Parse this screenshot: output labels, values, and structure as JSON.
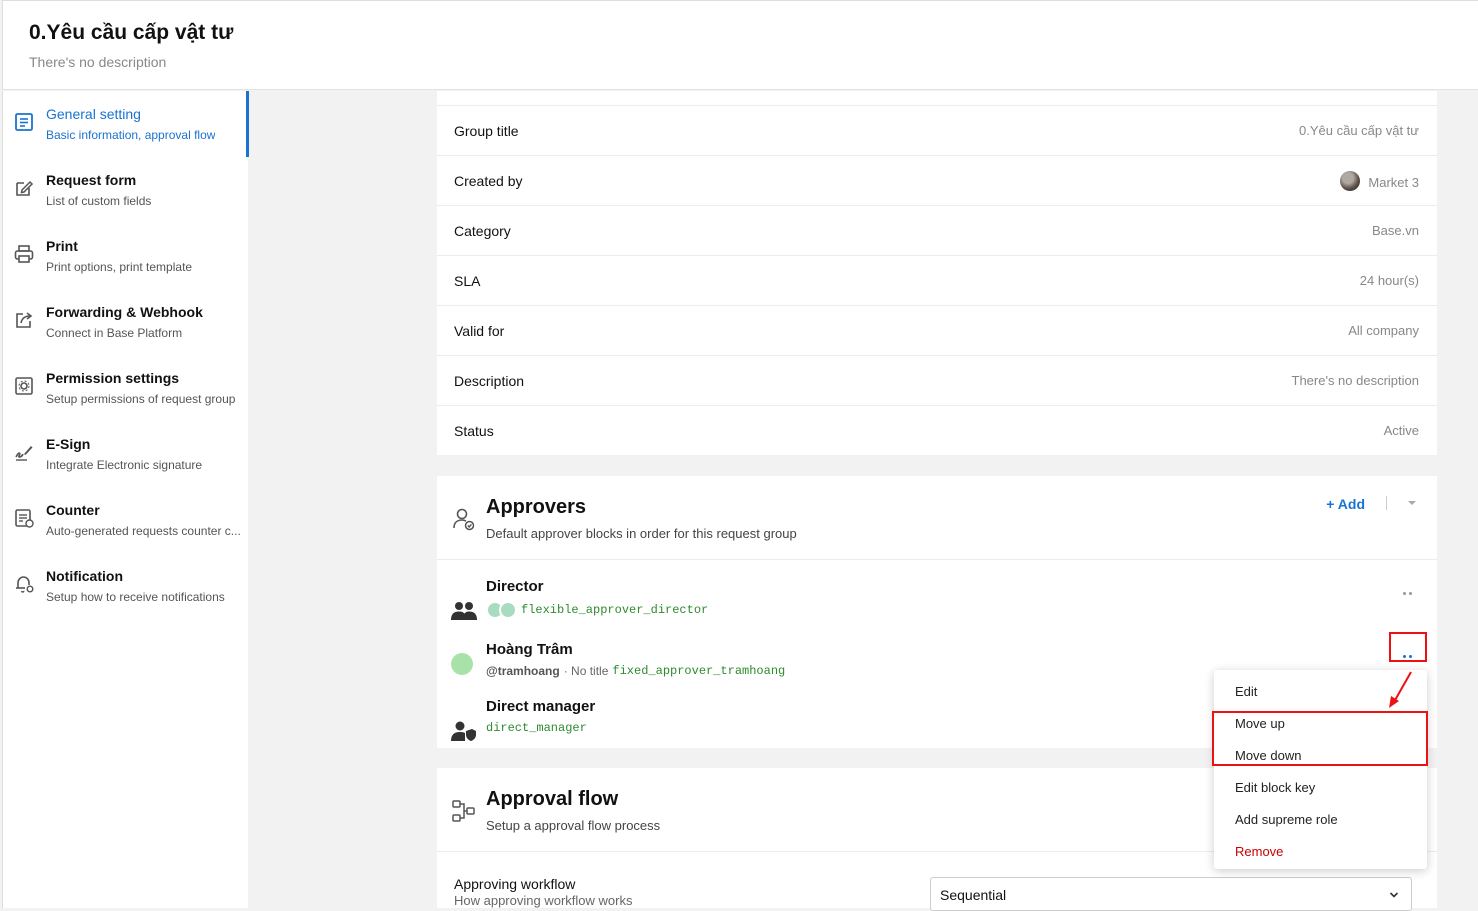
{
  "header": {
    "title": "0.Yêu cầu cấp vật tư",
    "description": "There's no description"
  },
  "sidebar": {
    "items": [
      {
        "label": "General setting",
        "sub": "Basic information, approval flow",
        "icon": "document-icon",
        "active": true
      },
      {
        "label": "Request form",
        "sub": "List of custom fields",
        "icon": "edit-icon"
      },
      {
        "label": "Print",
        "sub": "Print options, print template",
        "icon": "printer-icon"
      },
      {
        "label": "Forwarding & Webhook",
        "sub": "Connect in Base Platform",
        "icon": "share-icon"
      },
      {
        "label": "Permission settings",
        "sub": "Setup permissions of request group",
        "icon": "gear-icon"
      },
      {
        "label": "E-Sign",
        "sub": "Integrate Electronic signature",
        "icon": "signature-icon"
      },
      {
        "label": "Counter",
        "sub": "Auto-generated requests counter c...",
        "icon": "counter-icon"
      },
      {
        "label": "Notification",
        "sub": "Setup how to receive notifications",
        "icon": "bell-icon"
      }
    ]
  },
  "info": {
    "rows": [
      {
        "key": "Group title",
        "value": "0.Yêu cầu cấp vật tư"
      },
      {
        "key": "Created by",
        "value": "Market 3"
      },
      {
        "key": "Category",
        "value": "Base.vn"
      },
      {
        "key": "SLA",
        "value": "24 hour(s)"
      },
      {
        "key": "Valid for",
        "value": "All company"
      },
      {
        "key": "Description",
        "value": "There's no description"
      },
      {
        "key": "Status",
        "value": "Active"
      }
    ]
  },
  "approvers": {
    "title": "Approvers",
    "subtitle": "Default approver blocks in order for this request group",
    "add_label": "Add",
    "items": [
      {
        "name": "Director",
        "code": "flexible_approver_director"
      },
      {
        "name": "Hoàng Trâm",
        "handle": "@tramhoang",
        "note": "· No title",
        "code": "fixed_approver_tramhoang"
      },
      {
        "name": "Direct manager",
        "code": "direct_manager"
      }
    ]
  },
  "flow": {
    "title": "Approval flow",
    "subtitle": "Setup a approval flow process",
    "workflow_label": "Approving workflow",
    "workflow_sub": "How approving workflow works",
    "workflow_value": "Sequential"
  },
  "menu": {
    "items": [
      "Edit",
      "Move up",
      "Move down",
      "Edit block key",
      "Add supreme role",
      "Remove"
    ]
  },
  "colors": {
    "accent": "#1a73d0",
    "danger": "#cc0000",
    "code": "#2e8b2e",
    "annotation": "#ee1111"
  }
}
